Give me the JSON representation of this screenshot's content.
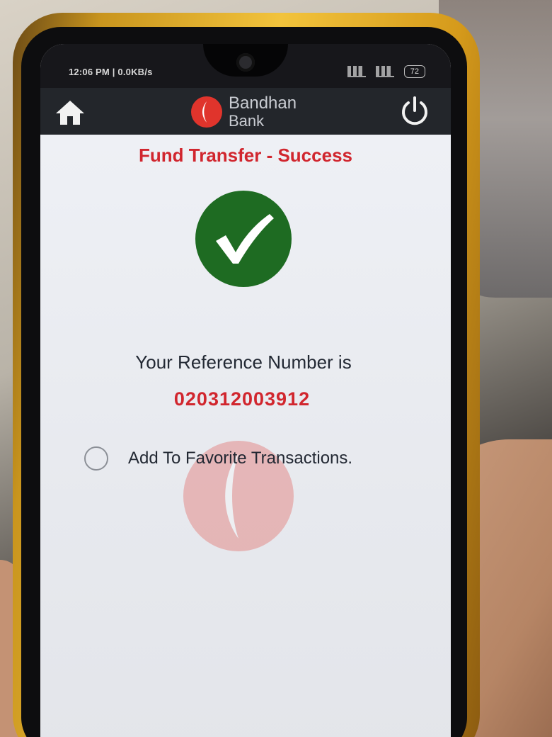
{
  "status_bar": {
    "time_text": "12:06 PM | 0.0KB/s",
    "battery": "72"
  },
  "app_bar": {
    "home_icon": "home-icon",
    "logo_line1": "Bandhan",
    "logo_line2": "Bank",
    "power_icon": "power-icon"
  },
  "screen": {
    "title": "Fund Transfer - Success",
    "success_icon": "checkmark-icon",
    "reference_label": "Your Reference Number is",
    "reference_number": "020312003912",
    "favorite_option": {
      "label": "Add To Favorite Transactions.",
      "checked": false
    }
  },
  "colors": {
    "accent_red": "#d1262e",
    "success_green": "#1e6b22",
    "app_bar_bg": "#23262b"
  }
}
